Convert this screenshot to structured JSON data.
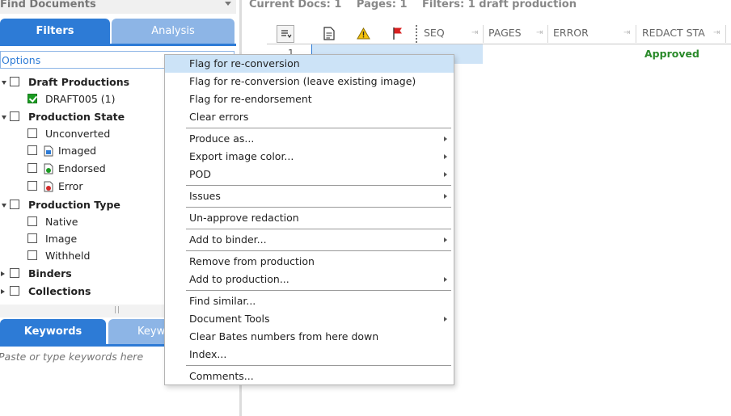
{
  "find_documents": {
    "title": "Find Documents"
  },
  "tabs": {
    "filters": "Filters",
    "analysis": "Analysis"
  },
  "options_label": "Options",
  "tree": {
    "draft_productions": "Draft Productions",
    "draft005": "DRAFT005 (1)",
    "production_state": "Production State",
    "unconverted": "Unconverted",
    "imaged": "Imaged",
    "endorsed": "Endorsed",
    "error": "Error",
    "production_type": "Production Type",
    "native": "Native",
    "image": "Image",
    "withheld": "Withheld",
    "binders": "Binders",
    "collections": "Collections"
  },
  "keywords": {
    "tab_label": "Keywords",
    "tab2_label": "Keyw",
    "placeholder": "Paste or type keywords here"
  },
  "status_bar": {
    "current_docs": "Current Docs: 1",
    "pages": "Pages: 1",
    "filters": "Filters: 1 draft production"
  },
  "grid": {
    "columns": {
      "seq": "SEQ",
      "pages": "PAGES",
      "error": "ERROR",
      "redact_status": "REDACT STA"
    },
    "rows": [
      {
        "num": "1",
        "redact_status": "Approved"
      }
    ],
    "colors": {
      "approved": "#2a8a2a",
      "selection": "#cfe4f7"
    }
  },
  "context_menu": {
    "items": {
      "flag_reconversion": "Flag for re-conversion",
      "flag_reconversion_leave": "Flag for re-conversion (leave existing image)",
      "flag_reendorsement": "Flag for re-endorsement",
      "clear_errors": "Clear errors",
      "produce_as": "Produce as...",
      "export_image_color": "Export image color...",
      "pod": "POD",
      "issues": "Issues",
      "unapprove_redaction": "Un-approve redaction",
      "add_to_binder": "Add to binder...",
      "remove_from_production": "Remove from production",
      "add_to_production": "Add to production...",
      "find_similar": "Find similar...",
      "document_tools": "Document Tools",
      "clear_bates": "Clear Bates numbers from here down",
      "index": "Index...",
      "comments": "Comments..."
    }
  }
}
